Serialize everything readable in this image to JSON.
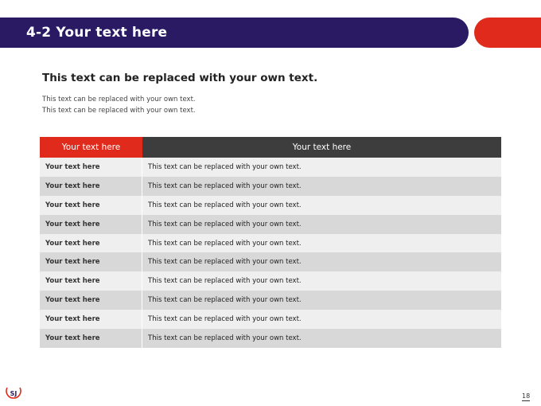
{
  "header": {
    "title": "4-2 Your text here",
    "bar_color": "#2a1a63",
    "accent_color": "#e02a1b"
  },
  "content": {
    "subtitle": "This text can be replaced with your own text.",
    "description_lines": [
      "This text can be replaced with your own text.",
      "This text can be replaced with your own text."
    ]
  },
  "table": {
    "headers": [
      "Your text here",
      "Your text here"
    ],
    "rows": [
      [
        "Your text here",
        "This text can be replaced with your own text."
      ],
      [
        "Your text here",
        "This text can be replaced with your own text."
      ],
      [
        "Your text here",
        "This text can be replaced with your own text."
      ],
      [
        "Your text here",
        "This text can be replaced with your own text."
      ],
      [
        "Your text here",
        "This text can be replaced with your own text."
      ],
      [
        "Your text here",
        "This text can be replaced with your own text."
      ],
      [
        "Your text here",
        "This text can be replaced with your own text."
      ],
      [
        "Your text here",
        "This text can be replaced with your own text."
      ],
      [
        "Your text here",
        "This text can be replaced with your own text."
      ],
      [
        "Your text here",
        "This text can be replaced with your own text."
      ]
    ]
  },
  "footer": {
    "logo_text": "SJ",
    "page_number": "18"
  }
}
